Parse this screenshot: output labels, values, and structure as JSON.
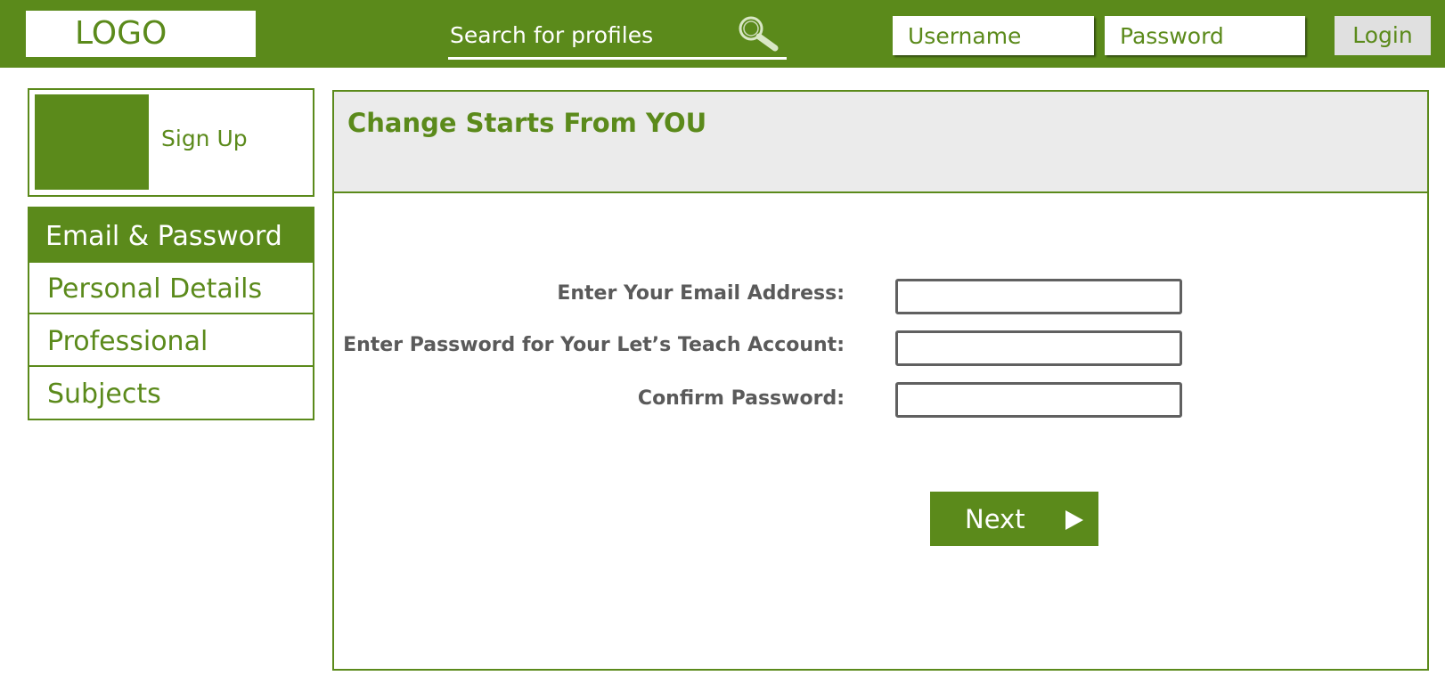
{
  "header": {
    "logo_text": "LOGO",
    "search_placeholder": "Search for profiles",
    "username_placeholder": "Username",
    "password_placeholder": "Password",
    "login_label": "Login"
  },
  "sidebar": {
    "signup_label": "Sign Up",
    "items": [
      {
        "label": "Email & Password"
      },
      {
        "label": "Personal Details"
      },
      {
        "label": "Professional"
      },
      {
        "label": "Subjects"
      }
    ]
  },
  "main": {
    "title": "Change Starts From YOU",
    "fields": [
      {
        "label": "Enter Your Email Address:",
        "value": ""
      },
      {
        "label": "Enter Password for Your Let’s Teach Account:",
        "value": ""
      },
      {
        "label": "Confirm Password:",
        "value": ""
      }
    ],
    "next_label": "Next"
  },
  "colors": {
    "brand_green": "#5b8a1b",
    "header_panel_gray": "#ebebeb",
    "login_button_gray": "#e0e0e0",
    "form_label_gray": "#5a5a5a"
  },
  "icons": {
    "search": "search-icon",
    "next_arrow": "play-arrow-icon"
  }
}
